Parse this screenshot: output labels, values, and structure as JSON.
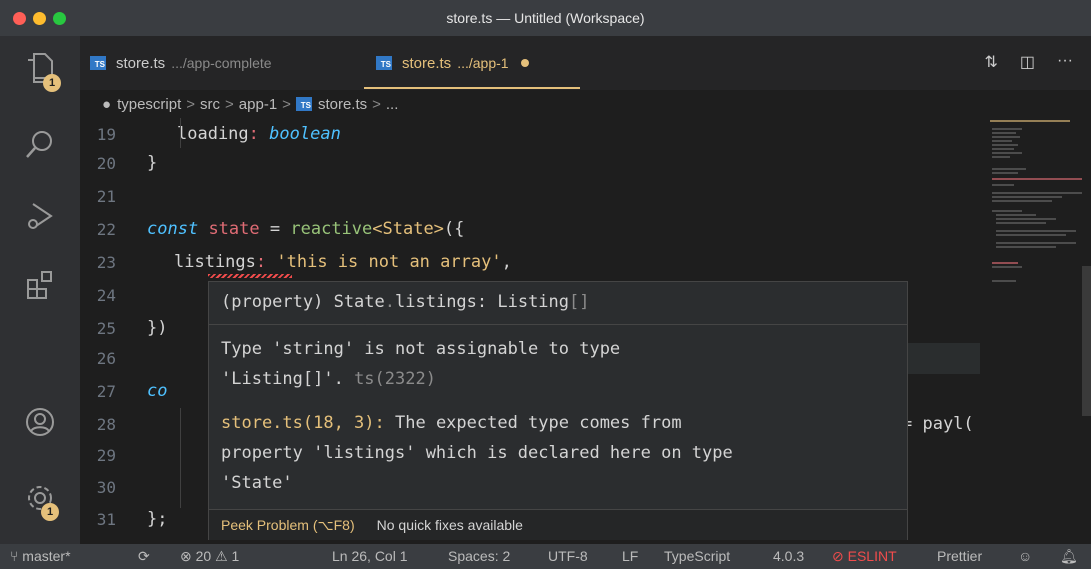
{
  "window": {
    "title": "store.ts — Untitled (Workspace)"
  },
  "activity_bar": {
    "items": [
      {
        "name": "explorer",
        "icon": "files-icon",
        "badge": "1"
      },
      {
        "name": "search",
        "icon": "search-icon"
      },
      {
        "name": "run-debug",
        "icon": "debug-icon"
      },
      {
        "name": "extensions",
        "icon": "extensions-icon"
      },
      {
        "name": "accounts",
        "icon": "account-icon"
      },
      {
        "name": "manage",
        "icon": "gear-icon",
        "badge": "1"
      }
    ]
  },
  "tabs": [
    {
      "label": "store.ts",
      "path": ".../app-complete",
      "icon": "TS",
      "active": false
    },
    {
      "label": "store.ts",
      "path": ".../app-1",
      "icon": "TS",
      "active": true,
      "dirty": true
    }
  ],
  "breadcrumb": {
    "items": [
      "typescript",
      "src",
      "app-1",
      "store.ts",
      "..."
    ],
    "sep": ">"
  },
  "editor": {
    "lines": [
      {
        "n": "19",
        "code": "loading: boolean"
      },
      {
        "n": "20",
        "code": "}"
      },
      {
        "n": "21",
        "code": ""
      },
      {
        "n": "22",
        "code": "const state = reactive<State>({"
      },
      {
        "n": "23",
        "code": "listings: 'this is not an array',"
      },
      {
        "n": "24",
        "code": ""
      },
      {
        "n": "25",
        "code": "})"
      },
      {
        "n": "26",
        "code": ""
      },
      {
        "n": "27",
        "code": "co"
      },
      {
        "n": "28",
        "code": "= payl("
      },
      {
        "n": "29",
        "code": ""
      },
      {
        "n": "30",
        "code": ""
      },
      {
        "n": "31",
        "code": "};"
      }
    ]
  },
  "hover": {
    "signature_prefix": "(property) State",
    "signature_dot": ".",
    "signature_rest": "listings: Listing",
    "signature_brackets": "[]",
    "message_line1": "Type 'string' is not assignable to type",
    "message_line2": "'Listing[]'. ",
    "message_code": "ts(2322)",
    "related_location": "store.ts(18, 3):",
    "related_text": " The expected type comes from",
    "related_line2": "property 'listings' which is declared here on type",
    "related_line3": "'State'",
    "peek_label": "Peek Problem (⌥F8)",
    "no_fixes_label": "No quick fixes available"
  },
  "statusbar": {
    "branch": "master*",
    "errors": "20",
    "warnings": "1",
    "position": "Ln 26, Col 1",
    "spaces": "Spaces: 2",
    "encoding": "UTF-8",
    "eol": "LF",
    "language": "TypeScript",
    "version": "4.0.3",
    "eslint": "ESLINT",
    "formatter": "Prettier"
  },
  "colors": {
    "accent": "#e5c07b",
    "error": "#f14c4c",
    "ts_blue": "#3178c6"
  }
}
